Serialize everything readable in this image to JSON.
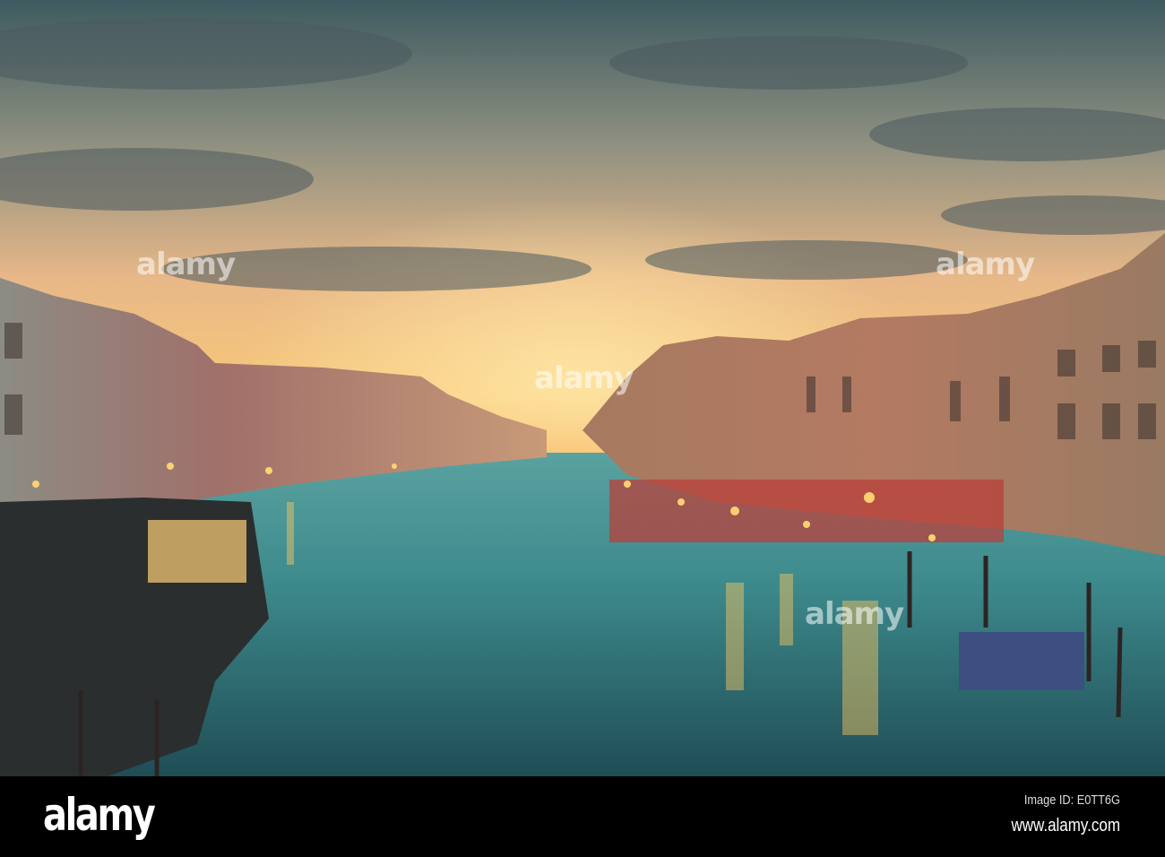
{
  "photo": {
    "subject": "Grand Canal at sunset",
    "colors": {
      "sky_top": "#3e5a60",
      "sky_glow": "#f7c878",
      "horizon": "#f4a94a",
      "water": "#3d8a8c",
      "water_dark": "#1f4d55"
    }
  },
  "watermark": {
    "text": "alamy"
  },
  "footer": {
    "logo": "alamy",
    "image_id": "Image ID: E0TT6G",
    "url": "www.alamy.com"
  }
}
